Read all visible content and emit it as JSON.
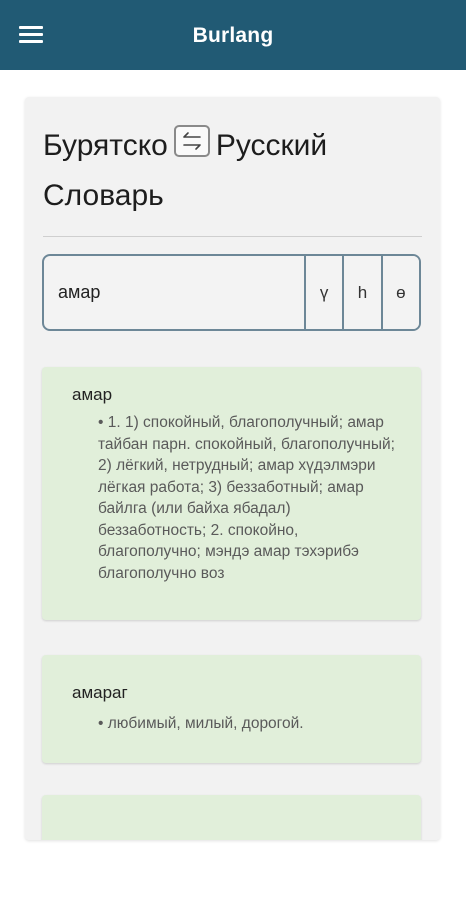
{
  "appbar": {
    "title": "Burlang"
  },
  "heading": {
    "from_lang": "Бурятско",
    "to_lang": "Русский",
    "subtitle": "Словарь"
  },
  "search": {
    "value": "амар",
    "letters": [
      "ү",
      "һ",
      "ө"
    ]
  },
  "entries": [
    {
      "word": "амар",
      "definition": "• 1. 1) спокойный, благополучный; амар тайбан парн. спокойный, благополучный; 2) лёгкий, нетрудный; амар хүдэлмэри лёгкая работа; 3) беззаботный; амар байлга (или байха ябадал) беззаботность; 2. спокойно, благополучно; мэндэ амар тэхэрибэ благополучно воз"
    },
    {
      "word": "амараг",
      "definition": "• любимый, милый, дорогой."
    }
  ],
  "colors": {
    "appbar": "#215a74",
    "entry_bg": "#e1efda",
    "card_bg": "#f2f2f2",
    "search_border": "#6d8797"
  },
  "icons": {
    "menu": "hamburger-menu-icon",
    "swap": "swap-arrows-icon"
  }
}
